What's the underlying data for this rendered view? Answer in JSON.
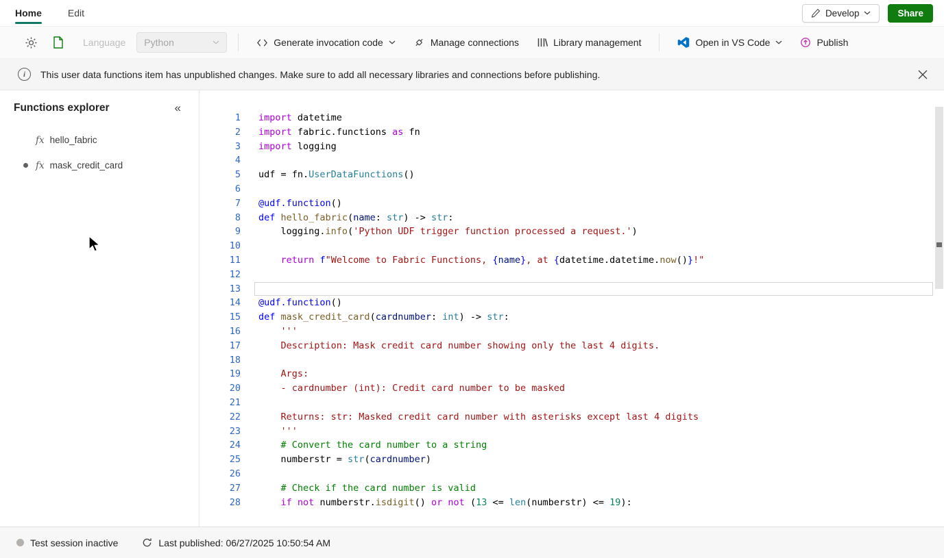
{
  "colors": {
    "tab_underline": "#117865",
    "share_button": "#107c10",
    "vscode_blue": "#0071c5",
    "publish_pink": "#c239b3",
    "line_number": "#2e66c0",
    "syntax": {
      "kw": "#af00db",
      "def": "#0000ff",
      "fn": "#795e26",
      "ty": "#267f99",
      "var": "#001080",
      "str": "#a31515",
      "com": "#008000",
      "num": "#098658",
      "pl": "#000000"
    }
  },
  "topbar": {
    "tabs": [
      {
        "label": "Home",
        "active": true
      },
      {
        "label": "Edit",
        "active": false
      }
    ],
    "develop_label": "Develop",
    "share_label": "Share"
  },
  "toolbar": {
    "language_label": "Language",
    "language_value": "Python",
    "generate_label": "Generate invocation code",
    "manage_label": "Manage connections",
    "library_label": "Library management",
    "vscode_label": "Open in VS Code",
    "publish_label": "Publish"
  },
  "banner": {
    "text": "This user data functions item has unpublished changes. Make sure to add all necessary libraries and connections before publishing."
  },
  "explorer": {
    "title": "Functions explorer",
    "collapse_glyph": "«",
    "items": [
      {
        "label": "hello_fabric",
        "modified": false
      },
      {
        "label": "mask_credit_card",
        "modified": true
      }
    ]
  },
  "editor": {
    "current_line": 13,
    "lines": [
      {
        "n": 1,
        "tokens": [
          [
            "kw",
            "import"
          ],
          [
            "pl",
            " datetime"
          ]
        ]
      },
      {
        "n": 2,
        "tokens": [
          [
            "kw",
            "import"
          ],
          [
            "pl",
            " fabric.functions "
          ],
          [
            "kw",
            "as"
          ],
          [
            "pl",
            " fn"
          ]
        ]
      },
      {
        "n": 3,
        "tokens": [
          [
            "kw",
            "import"
          ],
          [
            "pl",
            " logging"
          ]
        ]
      },
      {
        "n": 4,
        "tokens": []
      },
      {
        "n": 5,
        "tokens": [
          [
            "pl",
            "udf = fn."
          ],
          [
            "ty",
            "UserDataFunctions"
          ],
          [
            "pl",
            "()"
          ]
        ]
      },
      {
        "n": 6,
        "tokens": []
      },
      {
        "n": 7,
        "tokens": [
          [
            "def",
            "@udf.function"
          ],
          [
            "pl",
            "()"
          ]
        ]
      },
      {
        "n": 8,
        "tokens": [
          [
            "def",
            "def"
          ],
          [
            "fn",
            " hello_fabric"
          ],
          [
            "pl",
            "("
          ],
          [
            "var",
            "name"
          ],
          [
            "pl",
            ": "
          ],
          [
            "ty",
            "str"
          ],
          [
            "pl",
            ") -> "
          ],
          [
            "ty",
            "str"
          ],
          [
            "pl",
            ":"
          ]
        ]
      },
      {
        "n": 9,
        "tokens": [
          [
            "pl",
            "    logging."
          ],
          [
            "fn",
            "info"
          ],
          [
            "pl",
            "("
          ],
          [
            "str",
            "'Python UDF trigger function processed a request.'"
          ],
          [
            "pl",
            ")"
          ]
        ]
      },
      {
        "n": 10,
        "tokens": []
      },
      {
        "n": 11,
        "tokens": [
          [
            "pl",
            "    "
          ],
          [
            "kw",
            "return"
          ],
          [
            "pl",
            " "
          ],
          [
            "def",
            "f"
          ],
          [
            "str",
            "\"Welcome to Fabric Functions, "
          ],
          [
            "def",
            "{"
          ],
          [
            "var",
            "name"
          ],
          [
            "def",
            "}"
          ],
          [
            "str",
            ", at "
          ],
          [
            "def",
            "{"
          ],
          [
            "pl",
            "datetime.datetime."
          ],
          [
            "fn",
            "now"
          ],
          [
            "pl",
            "()"
          ],
          [
            "def",
            "}"
          ],
          [
            "str",
            "!\""
          ]
        ]
      },
      {
        "n": 12,
        "tokens": []
      },
      {
        "n": 13,
        "tokens": []
      },
      {
        "n": 14,
        "tokens": [
          [
            "def",
            "@udf.function"
          ],
          [
            "pl",
            "()"
          ]
        ]
      },
      {
        "n": 15,
        "tokens": [
          [
            "def",
            "def"
          ],
          [
            "fn",
            " mask_credit_card"
          ],
          [
            "pl",
            "("
          ],
          [
            "var",
            "cardnumber"
          ],
          [
            "pl",
            ": "
          ],
          [
            "ty",
            "int"
          ],
          [
            "pl",
            ") -> "
          ],
          [
            "ty",
            "str"
          ],
          [
            "pl",
            ":"
          ]
        ]
      },
      {
        "n": 16,
        "tokens": [
          [
            "str",
            "    '''"
          ]
        ]
      },
      {
        "n": 17,
        "tokens": [
          [
            "str",
            "    Description: Mask credit card number showing only the last 4 digits."
          ]
        ]
      },
      {
        "n": 18,
        "tokens": []
      },
      {
        "n": 19,
        "tokens": [
          [
            "str",
            "    Args:"
          ]
        ]
      },
      {
        "n": 20,
        "tokens": [
          [
            "str",
            "    - cardnumber (int): Credit card number to be masked"
          ]
        ]
      },
      {
        "n": 21,
        "tokens": []
      },
      {
        "n": 22,
        "tokens": [
          [
            "str",
            "    Returns: str: Masked credit card number with asterisks except last 4 digits"
          ]
        ]
      },
      {
        "n": 23,
        "tokens": [
          [
            "str",
            "    '''"
          ]
        ]
      },
      {
        "n": 24,
        "tokens": [
          [
            "com",
            "    # Convert the card number to a string"
          ]
        ]
      },
      {
        "n": 25,
        "tokens": [
          [
            "pl",
            "    numberstr = "
          ],
          [
            "ty",
            "str"
          ],
          [
            "pl",
            "("
          ],
          [
            "var",
            "cardnumber"
          ],
          [
            "pl",
            ")"
          ]
        ]
      },
      {
        "n": 26,
        "tokens": []
      },
      {
        "n": 27,
        "tokens": [
          [
            "com",
            "    # Check if the card number is valid"
          ]
        ]
      },
      {
        "n": 28,
        "tokens": [
          [
            "pl",
            "    "
          ],
          [
            "kw",
            "if"
          ],
          [
            "pl",
            " "
          ],
          [
            "kw",
            "not"
          ],
          [
            "pl",
            " numberstr."
          ],
          [
            "fn",
            "isdigit"
          ],
          [
            "pl",
            "() "
          ],
          [
            "kw",
            "or"
          ],
          [
            "pl",
            " "
          ],
          [
            "kw",
            "not"
          ],
          [
            "pl",
            " ("
          ],
          [
            "num",
            "13"
          ],
          [
            "pl",
            " <= "
          ],
          [
            "ty",
            "len"
          ],
          [
            "pl",
            "(numberstr) <= "
          ],
          [
            "num",
            "19"
          ],
          [
            "pl",
            "):"
          ]
        ]
      }
    ]
  },
  "statusbar": {
    "session": "Test session inactive",
    "published": "Last published: 06/27/2025 10:50:54 AM"
  }
}
